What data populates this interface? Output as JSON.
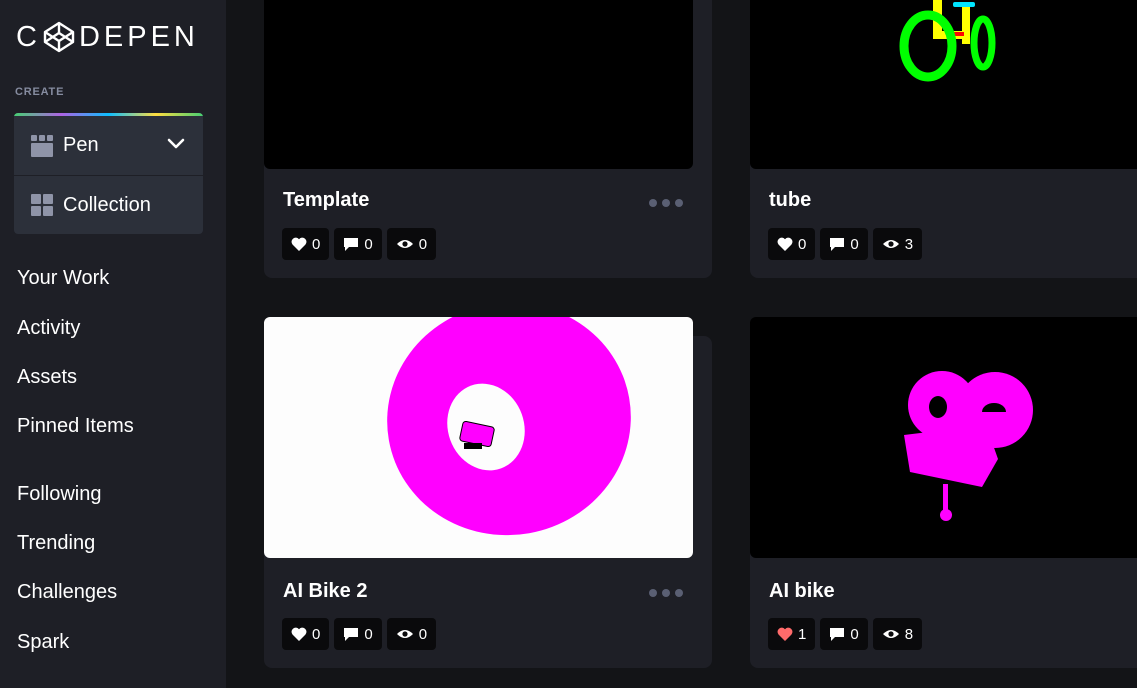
{
  "sidebar": {
    "logo_text_left": "C",
    "logo_text_right": "DEPEN",
    "create_label": "CREATE",
    "create_items": [
      {
        "label": "Pen",
        "icon": "pen-grid-icon"
      },
      {
        "label": "Collection",
        "icon": "collection-grid-icon"
      }
    ],
    "nav_primary": [
      "Your Work",
      "Activity",
      "Assets",
      "Pinned Items"
    ],
    "nav_secondary": [
      "Following",
      "Trending",
      "Challenges",
      "Spark"
    ]
  },
  "cards": [
    {
      "title": "Template",
      "likes": "0",
      "comments": "0",
      "views": "0",
      "liked": false
    },
    {
      "title": "tube",
      "likes": "0",
      "comments": "0",
      "views": "3",
      "liked": false
    },
    {
      "title": "AI Bike 2",
      "likes": "0",
      "comments": "0",
      "views": "0",
      "liked": false
    },
    {
      "title": "AI bike",
      "likes": "1",
      "comments": "0",
      "views": "8",
      "liked": true
    }
  ],
  "colors": {
    "sidebar_bg": "#1e1f26",
    "page_bg": "#131417",
    "card_bg": "#1e1f26",
    "liked_heart": "#ff6b6b",
    "magenta": "#ff00ff"
  }
}
